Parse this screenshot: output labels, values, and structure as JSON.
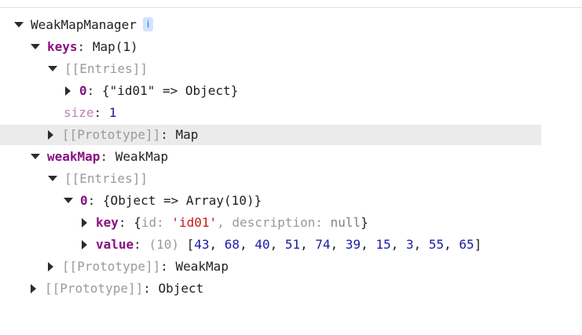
{
  "tree": {
    "root": {
      "label": "WeakMapManager",
      "badge": "i"
    },
    "keys": {
      "key": "keys",
      "sep": ":",
      "value": "Map(1)"
    },
    "keys_entries": {
      "label": "[[Entries]]"
    },
    "keys_entry0": {
      "index": "0",
      "sep": ":",
      "open": "{",
      "str": "\"id01\"",
      "arrow": " => ",
      "obj": "Object",
      "close": "}"
    },
    "keys_size": {
      "key": "size",
      "sep": ":",
      "value": "1"
    },
    "keys_proto": {
      "label": "[[Prototype]]",
      "sep": ":",
      "value": "Map"
    },
    "weakmap": {
      "key": "weakMap",
      "sep": ":",
      "value": "WeakMap"
    },
    "weakmap_entries": {
      "label": "[[Entries]]"
    },
    "weakmap_entry0": {
      "index": "0",
      "sep": ":",
      "value": "{Object => Array(10)}"
    },
    "entry_key": {
      "key": "key",
      "sep": ":",
      "open": "{",
      "id_key": "id",
      "id_sep": ": ",
      "id_value": "'id01'",
      "comma": ", ",
      "desc_key": "description",
      "desc_sep": ": ",
      "desc_value": "null",
      "close": "}"
    },
    "entry_value": {
      "key": "value",
      "sep": ":",
      "count": "(10)",
      "open": "[",
      "values": [
        "43",
        "68",
        "40",
        "51",
        "74",
        "39",
        "15",
        "3",
        "55",
        "65"
      ],
      "close": "]"
    },
    "weakmap_proto": {
      "label": "[[Prototype]]",
      "sep": ":",
      "value": "WeakMap"
    },
    "root_proto": {
      "label": "[[Prototype]]",
      "sep": ":",
      "value": "Object"
    }
  }
}
